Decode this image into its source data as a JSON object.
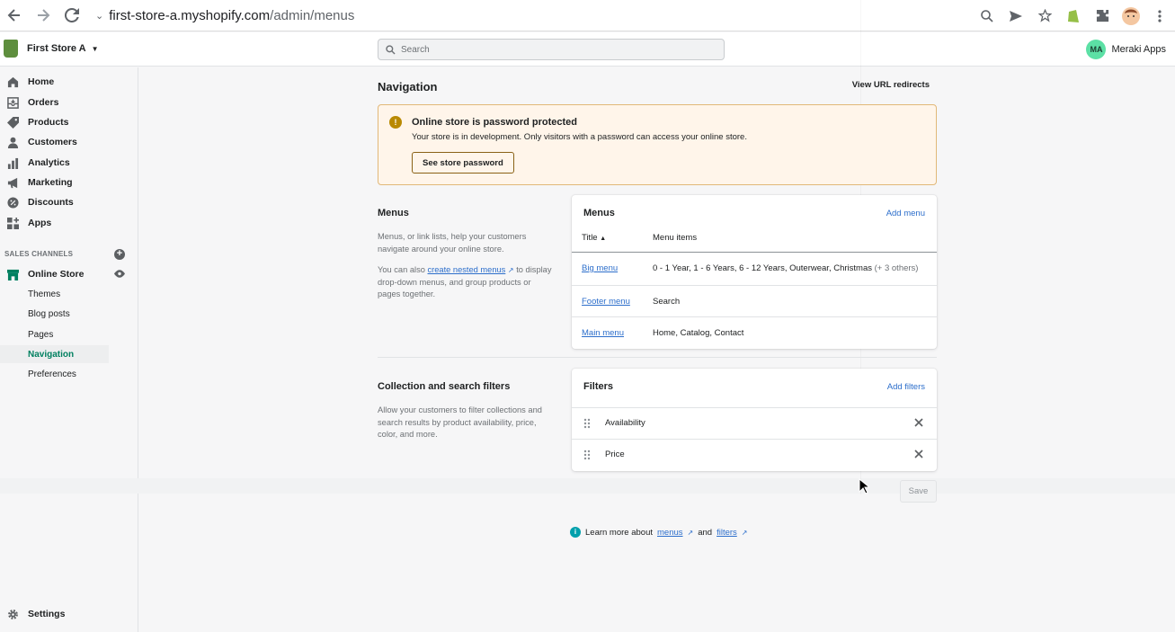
{
  "browser": {
    "url_host": "first-store-a.myshopify.com",
    "url_path": "/admin/menus"
  },
  "topbar": {
    "store_name": "First Store A",
    "search_placeholder": "Search",
    "user_initials": "MA",
    "user_name": "Meraki Apps",
    "avatar_color": "#5ce0a5"
  },
  "sidebar": {
    "items": [
      {
        "label": "Home",
        "icon": "home-icon"
      },
      {
        "label": "Orders",
        "icon": "orders-icon"
      },
      {
        "label": "Products",
        "icon": "tag-icon"
      },
      {
        "label": "Customers",
        "icon": "person-icon"
      },
      {
        "label": "Analytics",
        "icon": "bar-chart-icon"
      },
      {
        "label": "Marketing",
        "icon": "megaphone-icon"
      },
      {
        "label": "Discounts",
        "icon": "discount-icon"
      },
      {
        "label": "Apps",
        "icon": "apps-icon"
      }
    ],
    "channels_header": "SALES CHANNELS",
    "online_store": "Online Store",
    "sub_items": [
      "Themes",
      "Blog posts",
      "Pages",
      "Navigation",
      "Preferences"
    ],
    "settings": "Settings",
    "accent": "#008060"
  },
  "main": {
    "title": "Navigation",
    "url_redirects": "View URL redirects",
    "banner": {
      "title": "Online store is password protected",
      "text": "Your store is in development. Only visitors with a password can access your online store.",
      "button": "See store password"
    },
    "menus_section": {
      "title": "Menus",
      "desc1": "Menus, or link lists, help your customers navigate around your online store.",
      "desc2_pre": "You can also",
      "desc2_link": "create nested menus",
      "desc2_post": "to display drop-down menus, and group products or pages together."
    },
    "menus_card": {
      "title": "Menus",
      "action": "Add menu",
      "col_title": "Title",
      "col_items": "Menu items",
      "rows": [
        {
          "title": "Big menu",
          "items": "0 - 1 Year, 1 - 6 Years, 6 - 12 Years, Outerwear, Christmas",
          "more": "(+ 3 others)"
        },
        {
          "title": "Footer menu",
          "items": "Search",
          "more": ""
        },
        {
          "title": "Main menu",
          "items": "Home, Catalog, Contact",
          "more": ""
        }
      ]
    },
    "filters_section": {
      "title": "Collection and search filters",
      "desc": "Allow your customers to filter collections and search results by product availability, price, color, and more."
    },
    "filters_card": {
      "title": "Filters",
      "action": "Add filters",
      "rows": [
        "Availability",
        "Price"
      ]
    },
    "save": "Save",
    "learn": {
      "pre": "Learn more about",
      "link1": "menus",
      "mid": "and",
      "link2": "filters"
    }
  }
}
